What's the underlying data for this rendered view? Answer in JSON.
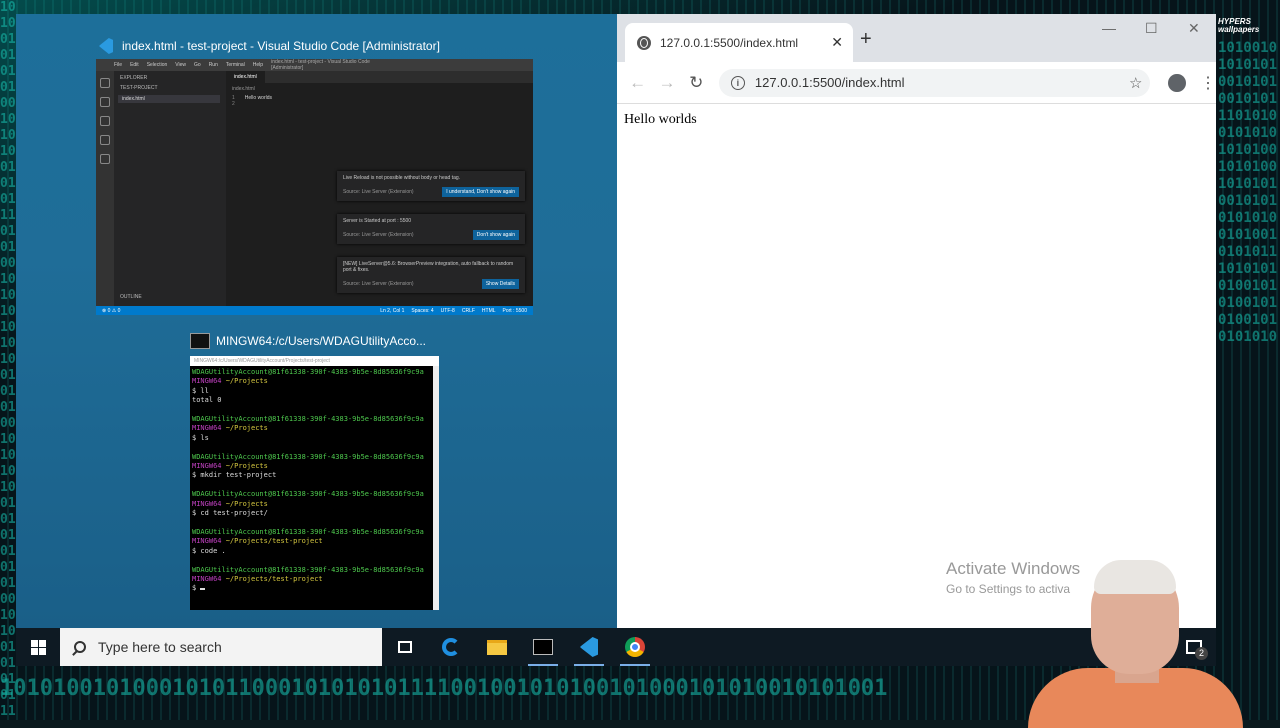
{
  "vscode_window": {
    "title": "index.html - test-project - Visual Studio Code [Administrator]",
    "menu": [
      "File",
      "Edit",
      "Selection",
      "View",
      "Go",
      "Run",
      "Terminal",
      "Help"
    ],
    "inner_title": "index.html - test-project - Visual Studio Code [Administrator]",
    "explorer_header": "EXPLORER",
    "folder": "TEST-PROJECT",
    "file": "index.html",
    "outline": "OUTLINE",
    "tab": "index.html",
    "breadcrumb": "index.html",
    "lines": [
      {
        "n": "1",
        "text": "Hello worlds"
      },
      {
        "n": "2",
        "text": ""
      }
    ],
    "notifications": [
      {
        "message": "Live Reload is not possible without body or head tag.",
        "source": "Source: Live Server (Extension)",
        "button": "I understand, Don't show again"
      },
      {
        "message": "Server is Started at port : 5500",
        "source": "Source: Live Server (Extension)",
        "button": "Don't show again"
      },
      {
        "message": "[NEW] LiveServer@5.6: BrowserPreview integration, auto fallback to random port & fixes.",
        "source": "Source: Live Server (Extension)",
        "button": "Show Details"
      }
    ],
    "status_left": "⊗ 0 ⚠ 0",
    "status_right": [
      "Ln 2, Col 1",
      "Spaces: 4",
      "UTF-8",
      "CRLF",
      "HTML",
      "Port : 5500"
    ]
  },
  "terminal_window": {
    "title": "MINGW64:/c/Users/WDAGUtilityAcco...",
    "inner_title": "MINGW64:/c/Users/WDAGUtilityAccount/Projects/test-project",
    "user": "WDAGUtilityAccount@81f61338-390f-4383-9b5e-8d85636f9c9a",
    "blocks": [
      {
        "env": "MINGW64",
        "path": "~/Projects",
        "cmd": "$ ll",
        "out": "total 0"
      },
      {
        "env": "MINGW64",
        "path": "~/Projects",
        "cmd": "$ ls",
        "out": ""
      },
      {
        "env": "MINGW64",
        "path": "~/Projects",
        "cmd": "$ mkdir test-project",
        "out": ""
      },
      {
        "env": "MINGW64",
        "path": "~/Projects",
        "cmd": "$ cd test-project/",
        "out": ""
      },
      {
        "env": "MINGW64",
        "path": "~/Projects/test-project",
        "cmd": "$ code .",
        "out": ""
      },
      {
        "env": "MINGW64",
        "path": "~/Projects/test-project",
        "cmd": "$",
        "out": ""
      }
    ]
  },
  "browser": {
    "tab_title": "127.0.0.1:5500/index.html",
    "tab_close": "✕",
    "new_tab": "+",
    "address": "127.0.0.1:5500/index.html",
    "page_text": "Hello worlds",
    "window_controls": [
      "—",
      "☐",
      "✕"
    ],
    "activate_title": "Activate Windows",
    "activate_sub": "Go to Settings to activa"
  },
  "taskbar": {
    "search_placeholder": "Type here to search",
    "apps": [
      "task-view-icon",
      "edge-icon",
      "file-explorer-icon",
      "terminal-icon",
      "vscode-icon",
      "chrome-icon"
    ],
    "notification_count": "2"
  },
  "watermark": "HYPERS wallpapers",
  "colors": {
    "accent": "#007acc",
    "desktop": "#1d6f9a",
    "taskbar": "#0e1a23"
  }
}
